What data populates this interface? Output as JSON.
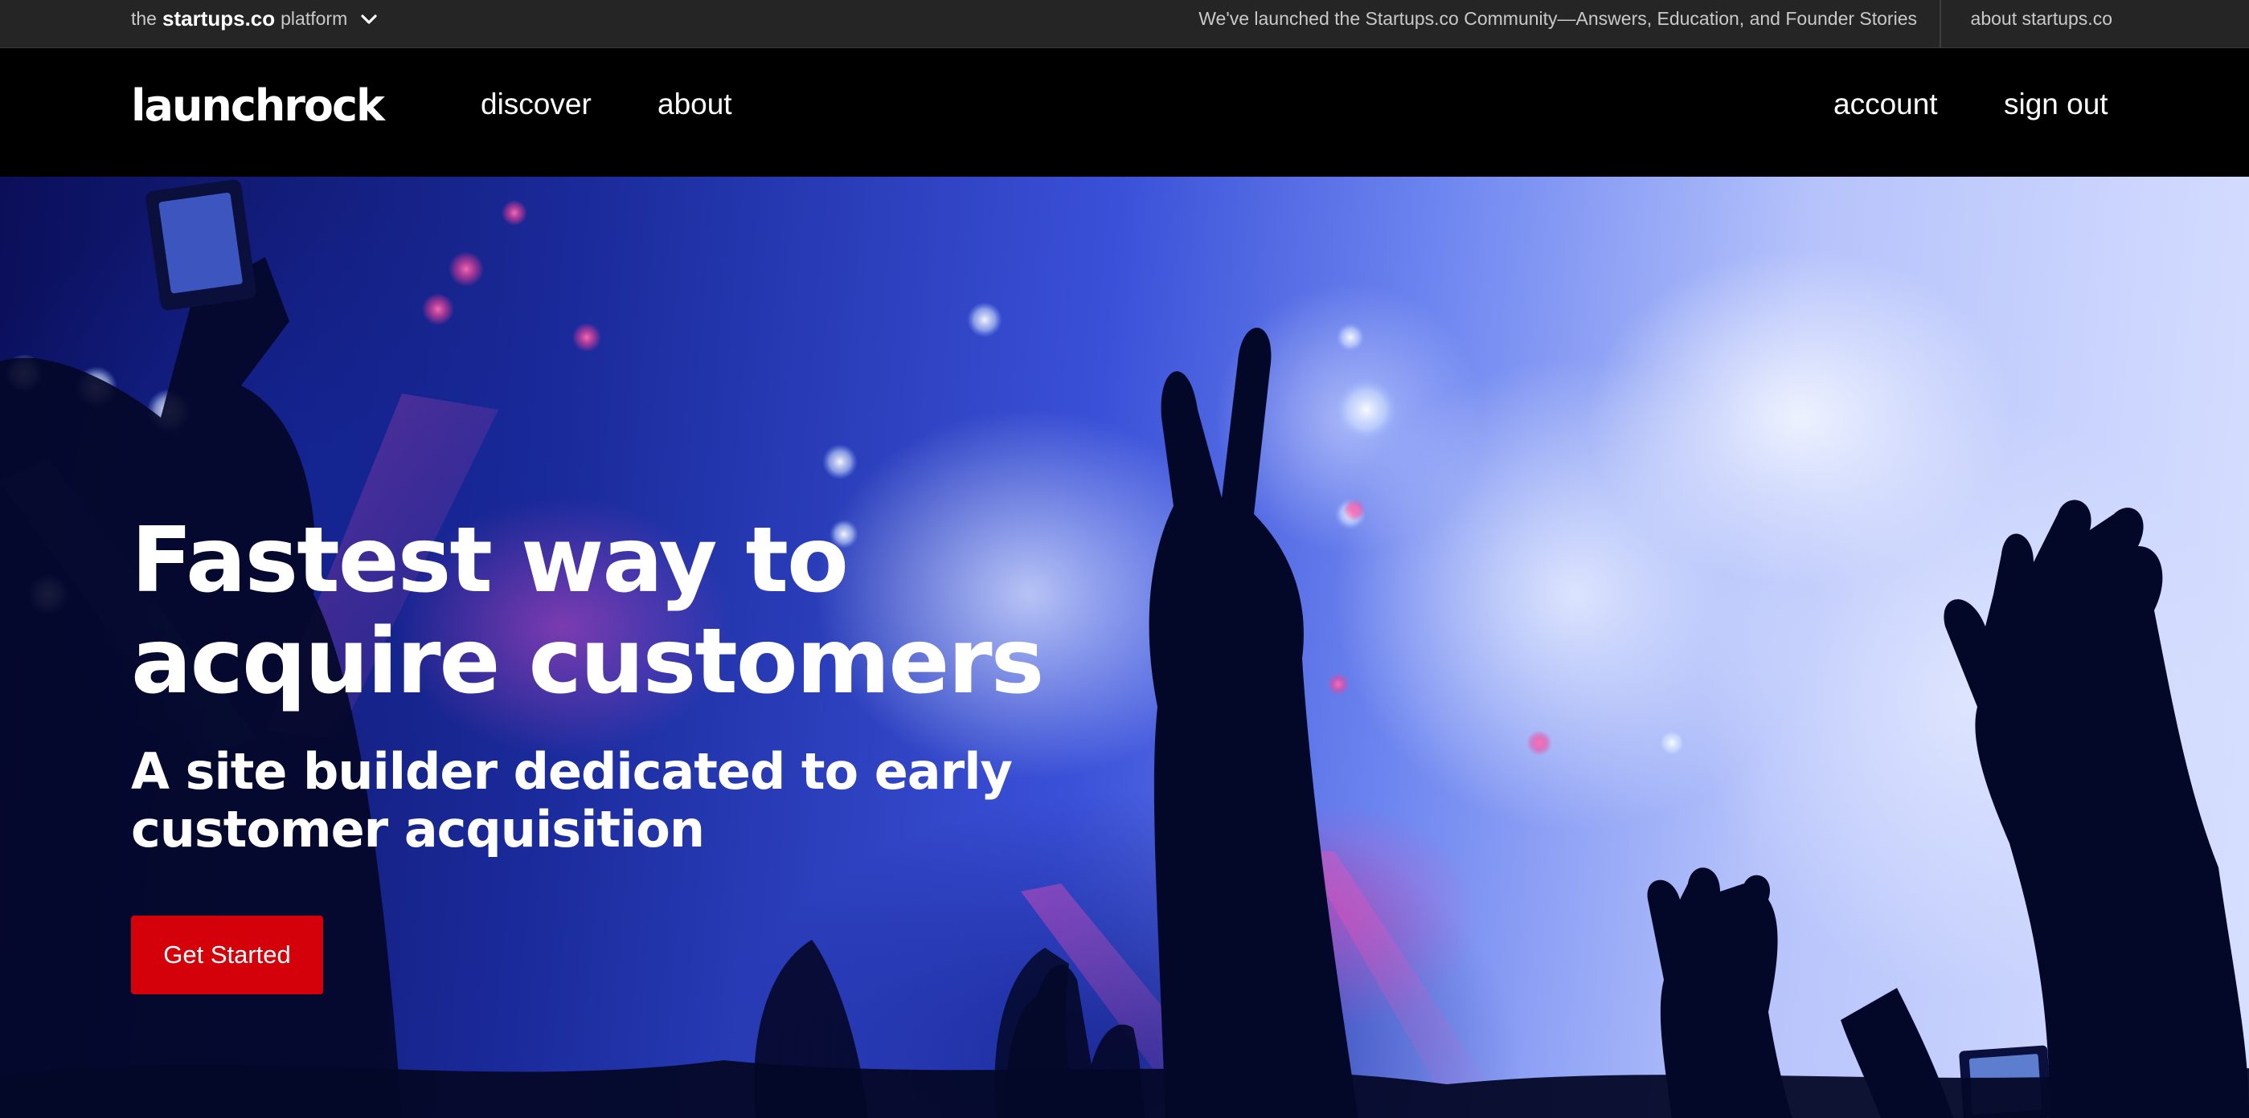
{
  "platform_bar": {
    "prefix": "the",
    "brand": "startups.co",
    "suffix": "platform",
    "announcement": "We've launched the Startups.co Community—Answers, Education, and Founder Stories",
    "about_link": "about startups.co"
  },
  "nav": {
    "logo": "launchrock",
    "discover": "discover",
    "about": "about",
    "account": "account",
    "sign_out": "sign out"
  },
  "hero": {
    "title": "Fastest way to acquire customers",
    "subtitle": "A site builder dedicated to early customer acquisition",
    "cta": "Get Started"
  },
  "colors": {
    "cta_red": "#d4000a",
    "platform_bar_bg": "#252525",
    "nav_bg": "#000000"
  },
  "icons": {
    "platform_dropdown": "chevron-down-icon"
  }
}
